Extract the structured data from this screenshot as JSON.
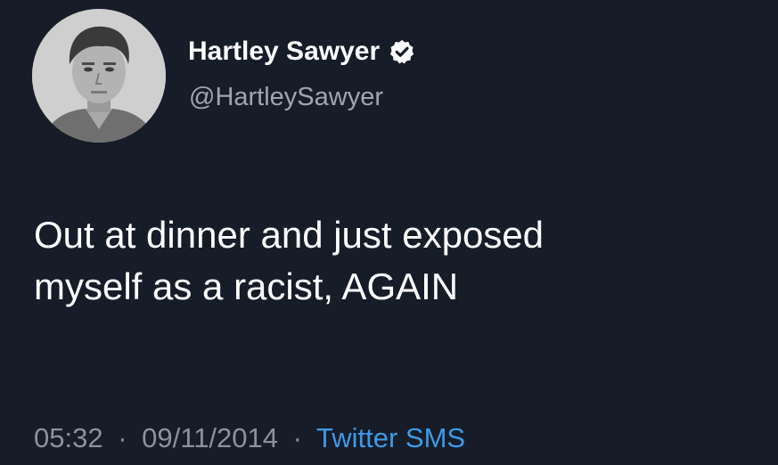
{
  "author": {
    "display_name": "Hartley Sawyer",
    "handle": "@HartleySawyer",
    "verified": true,
    "avatar": "profile-photo"
  },
  "tweet": {
    "text_lines": [
      "Out at dinner and just exposed",
      "myself as a racist, AGAIN"
    ],
    "time": "05:32",
    "date": "09/11/2014",
    "separator": "·",
    "source": "Twitter SMS"
  },
  "colors": {
    "background": "#161c28",
    "text": "#ffffff",
    "muted": "#8b929c",
    "link": "#3d9ae8"
  }
}
